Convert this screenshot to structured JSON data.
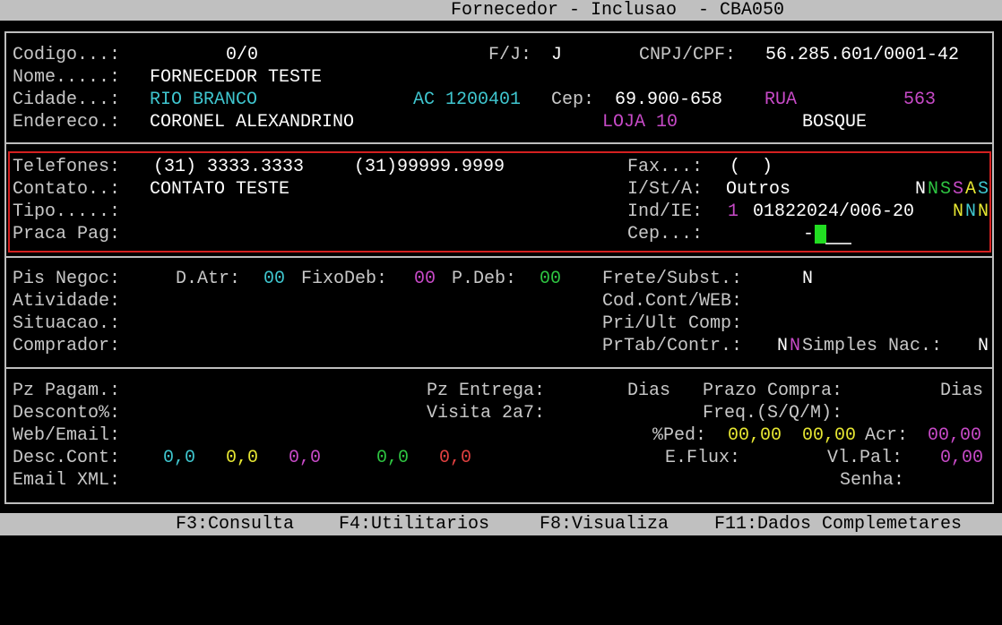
{
  "window": {
    "title": "Fornecedor - Inclusao  - CBA050"
  },
  "section1": {
    "codigo_label": "Codigo...:",
    "codigo_value": "0/0",
    "fj_label": "F/J:",
    "fj_value": "J",
    "cnpj_label": "CNPJ/CPF:",
    "cnpj_value": "56.285.601/0001-42",
    "nome_label": "Nome.....:",
    "nome_value": "FORNECEDOR TESTE",
    "cidade_label": "Cidade...:",
    "cidade_value": "RIO BRANCO",
    "uf_code": "AC 1200401",
    "cep_label": "Cep:",
    "cep_value": "69.900-658",
    "tipo_logradouro": "RUA",
    "numero": "563",
    "endereco_label": "Endereco.:",
    "endereco_value": "CORONEL ALEXANDRINO",
    "complemento": "LOJA 10",
    "bairro": "BOSQUE"
  },
  "section2": {
    "telefones_label": "Telefones:",
    "telefone1": "(31) 3333.3333",
    "telefone2": "(31)99999.9999",
    "fax_label": "Fax...:",
    "fax_value": "(  )",
    "contato_label": "Contato..:",
    "contato_value": "CONTATO TESTE",
    "ista_label": "I/St/A:",
    "ista_value": "Outros",
    "flags_n1": "N",
    "flags_n2": "N",
    "flags_s1": "S",
    "flags_s2": "S",
    "flags_a": "A",
    "flags_s3": "S",
    "tipo_label": "Tipo.....:",
    "indie_label": "Ind/IE:",
    "ind_value": "1",
    "ie_value": "01822024/006-20",
    "ie_f1": "N",
    "ie_f2": "N",
    "ie_f3": "N",
    "praca_label": "Praca Pag:",
    "cep2_label": "Cep...:",
    "cep2_dash": "-"
  },
  "section3": {
    "pis_label": "Pis Negoc:",
    "datr_label": "D.Atr:",
    "datr_value": "00",
    "fixodeb_label": "FixoDeb:",
    "fixodeb_value": "00",
    "pdeb_label": "P.Deb:",
    "pdeb_value": "00",
    "frete_label": "Frete/Subst.:",
    "frete_value": "N",
    "atividade_label": "Atividade:",
    "codcont_label": "Cod.Cont/WEB:",
    "situacao_label": "Situacao.:",
    "priult_label": "Pri/Ult Comp:",
    "comprador_label": "Comprador:",
    "prtab_label": "PrTab/Contr.:",
    "prtab_v1": "N",
    "prtab_v2": "N",
    "simples_label": "Simples Nac.:",
    "simples_value": "N"
  },
  "section4": {
    "pzpagam_label": "Pz Pagam.:",
    "pzentrega_label": "Pz Entrega:",
    "dias1": "Dias",
    "prazocompra_label": "Prazo Compra:",
    "dias2": "Dias",
    "desconto_label": "Desconto%:",
    "visita_label": "Visita 2a7:",
    "freq_label": "Freq.(S/Q/M):",
    "webemail_label": "Web/Email:",
    "ped_label": "%Ped:",
    "ped_v1": "00,00",
    "ped_v2": "00,00",
    "acr_label": "Acr:",
    "acr_value": "00,00",
    "desccont_label": "Desc.Cont:",
    "desc_v1": "0,0",
    "desc_v2": "0,0",
    "desc_v3": "0,0",
    "desc_v4": "0,0",
    "desc_v5": "0,0",
    "eflux_label": "E.Flux:",
    "vlpal_label": "Vl.Pal:",
    "vlpal_value": "0,00",
    "emailxml_label": "Email XML:",
    "senha_label": "Senha:"
  },
  "footer": {
    "f3": "F3:Consulta",
    "f4": "F4:Utilitarios",
    "f8": "F8:Visualiza",
    "f11": "F11:Dados Complemetares"
  },
  "colors": {
    "background": "#000000",
    "label": "#c8c8c8",
    "value": "#ffffff",
    "cyan": "#3fc6cf",
    "magenta": "#c74ac7",
    "green": "#2ec441",
    "yellow": "#e6e632",
    "red": "#e04040",
    "bar": "#c0c0c0",
    "highlight_box": "#d42020"
  }
}
